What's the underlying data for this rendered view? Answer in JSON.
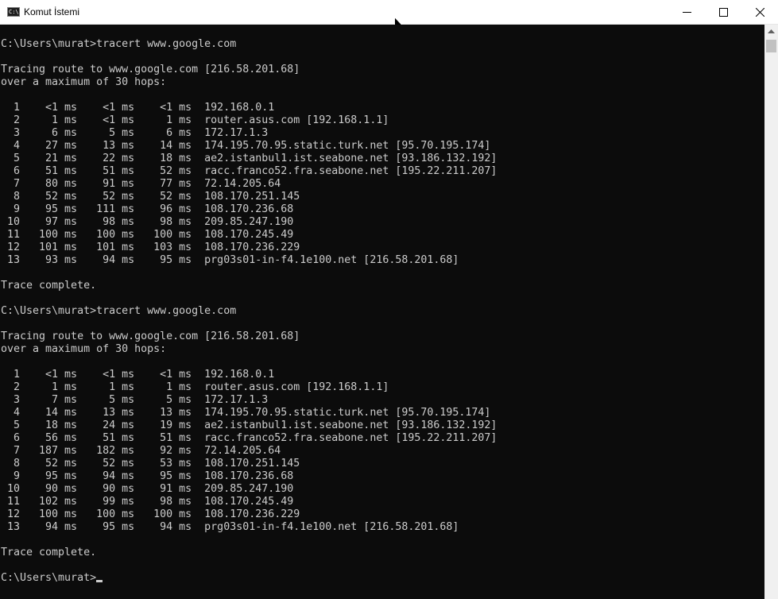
{
  "window": {
    "title": "Komut İstemi",
    "icon": "cmd-app-icon",
    "icon_text": "C:\\."
  },
  "controls": {
    "minimize_icon": "minimize-icon",
    "maximize_icon": "maximize-icon",
    "close_icon": "close-icon"
  },
  "colors": {
    "console_bg": "#0c0c0c",
    "console_text": "#cccccc",
    "titlebar_bg": "#ffffff"
  },
  "console": {
    "lines": [
      "C:\\Users\\murat>tracert www.google.com",
      "",
      "Tracing route to www.google.com [216.58.201.68]",
      "over a maximum of 30 hops:",
      "",
      "  1    <1 ms    <1 ms    <1 ms  192.168.0.1",
      "  2     1 ms    <1 ms     1 ms  router.asus.com [192.168.1.1]",
      "  3     6 ms     5 ms     6 ms  172.17.1.3",
      "  4    27 ms    13 ms    14 ms  174.195.70.95.static.turk.net [95.70.195.174]",
      "  5    21 ms    22 ms    18 ms  ae2.istanbul1.ist.seabone.net [93.186.132.192]",
      "  6    51 ms    51 ms    52 ms  racc.franco52.fra.seabone.net [195.22.211.207]",
      "  7    80 ms    91 ms    77 ms  72.14.205.64",
      "  8    52 ms    52 ms    52 ms  108.170.251.145",
      "  9    95 ms   111 ms    96 ms  108.170.236.68",
      " 10    97 ms    98 ms    98 ms  209.85.247.190",
      " 11   100 ms   100 ms   100 ms  108.170.245.49",
      " 12   101 ms   101 ms   103 ms  108.170.236.229",
      " 13    93 ms    94 ms    95 ms  prg03s01-in-f4.1e100.net [216.58.201.68]",
      "",
      "Trace complete.",
      "",
      "C:\\Users\\murat>tracert www.google.com",
      "",
      "Tracing route to www.google.com [216.58.201.68]",
      "over a maximum of 30 hops:",
      "",
      "  1    <1 ms    <1 ms    <1 ms  192.168.0.1",
      "  2     1 ms     1 ms     1 ms  router.asus.com [192.168.1.1]",
      "  3     7 ms     5 ms     5 ms  172.17.1.3",
      "  4    14 ms    13 ms    13 ms  174.195.70.95.static.turk.net [95.70.195.174]",
      "  5    18 ms    24 ms    19 ms  ae2.istanbul1.ist.seabone.net [93.186.132.192]",
      "  6    56 ms    51 ms    51 ms  racc.franco52.fra.seabone.net [195.22.211.207]",
      "  7   187 ms   182 ms    92 ms  72.14.205.64",
      "  8    52 ms    52 ms    53 ms  108.170.251.145",
      "  9    95 ms    94 ms    95 ms  108.170.236.68",
      " 10    90 ms    90 ms    91 ms  209.85.247.190",
      " 11   102 ms    99 ms    98 ms  108.170.245.49",
      " 12   100 ms   100 ms   100 ms  108.170.236.229",
      " 13    94 ms    95 ms    94 ms  prg03s01-in-f4.1e100.net [216.58.201.68]",
      "",
      "Trace complete.",
      ""
    ],
    "prompt": "C:\\Users\\murat>"
  },
  "scrollbar": {
    "up_icon": "scroll-up-arrow-icon"
  }
}
